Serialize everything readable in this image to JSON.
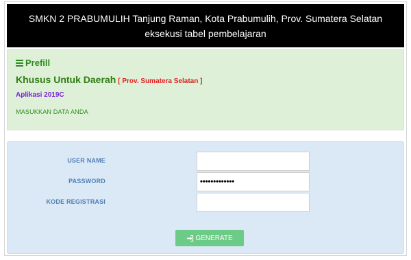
{
  "header": {
    "line1": "SMKN 2 PRABUMULIH Tanjung Raman, Kota Prabumulih, Prov. Sumatera Selatan",
    "line2": "eksekusi tabel pembelajaran"
  },
  "info": {
    "prefill_label": "Prefill",
    "prefill_icon": "list-icon",
    "khusus_label": "Khusus Untuk Daerah",
    "region": "[ Prov. Sumatera Selatan ]",
    "aplikasi": "Aplikasi 2019C",
    "instruction": "MASUKKAN DATA ANDA"
  },
  "form": {
    "username_label": "USER NAME",
    "username_value": "",
    "password_label": "PASSWORD",
    "password_value": "•••••••••••••",
    "kode_label": "KODE REGISTRASI",
    "kode_value": "",
    "generate_label": "GENERATE",
    "generate_icon": "sign-in-icon"
  },
  "colors": {
    "header_bg": "#000000",
    "info_bg": "#dff0d8",
    "form_bg": "#dbe9f6",
    "button_bg": "#6ccb86",
    "region_red": "#e02020",
    "aplikasi_purple": "#7a22d6"
  }
}
